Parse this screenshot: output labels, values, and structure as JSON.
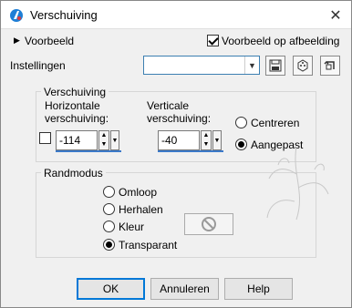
{
  "window": {
    "title": "Verschuiving",
    "close_glyph": "✕"
  },
  "top": {
    "preview_label": "Voorbeeld",
    "preview_on_image_label": "Voorbeeld op afbeelding",
    "preview_on_image_checked": true,
    "settings_label": "Instellingen",
    "settings_value": ""
  },
  "offset": {
    "group_label": "Verschuiving",
    "horizontal_label_1": "Horizontale",
    "horizontal_label_2": "verschuiving:",
    "horizontal_value": "-114",
    "vertical_label_1": "Verticale",
    "vertical_label_2": "verschuiving:",
    "vertical_value": "-40",
    "mode_center_label": "Centreren",
    "mode_custom_label": "Aangepast",
    "selected_mode": "custom"
  },
  "edge": {
    "group_label": "Randmodus",
    "options": [
      {
        "label": "Omloop",
        "selected": false
      },
      {
        "label": "Herhalen",
        "selected": false
      },
      {
        "label": "Kleur",
        "selected": false
      },
      {
        "label": "Transparant",
        "selected": true
      }
    ]
  },
  "buttons": {
    "ok": "OK",
    "cancel": "Annuleren",
    "help": "Help"
  },
  "colors": {
    "accent": "#0078d7",
    "field_underline": "#3b79c9"
  }
}
